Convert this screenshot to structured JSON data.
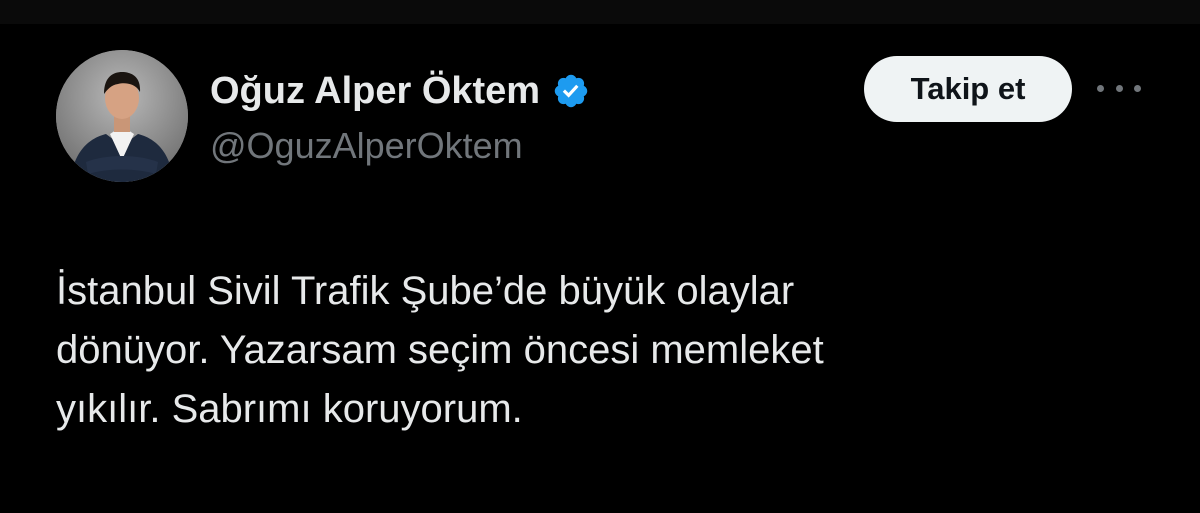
{
  "tweet": {
    "author": {
      "display_name": "Oğuz Alper Öktem",
      "handle": "@OguzAlperOktem",
      "verified": true,
      "avatar_icon": "profile-photo-icon"
    },
    "follow_button_label": "Takip et",
    "more_icon": "more-options-icon",
    "text": "İstanbul Sivil Trafik Şube’de büyük olaylar\ndönüyor. Yazarsam seçim öncesi memleket\nyıkılır.  Sabrımı koruyorum."
  },
  "colors": {
    "background": "#000000",
    "primary_text": "#e7e9ea",
    "secondary_text": "#71767b",
    "verified_badge": "#1d9bf0",
    "follow_button_bg": "#eff3f4",
    "follow_button_text": "#0f1419"
  }
}
